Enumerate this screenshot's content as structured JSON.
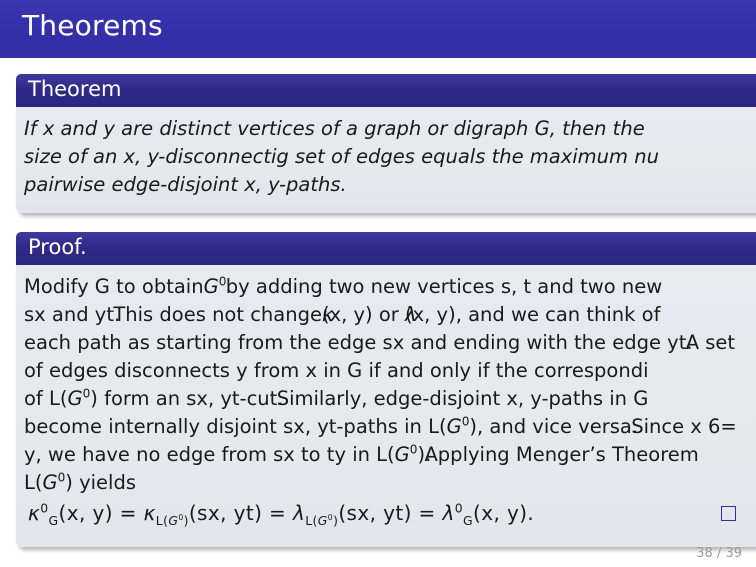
{
  "slide": {
    "title": "Theorems",
    "page_label": "38 / 39",
    "accent_color": "#332fa8",
    "block_head_color": "#2b2680",
    "block_body_color": "#e7e7f0",
    "page_number_color": "#9b9b9b"
  },
  "theorem_block": {
    "heading": "Theorem",
    "lines": [
      "If x and y are distinct vertices of a graph or digraph G, then the",
      "size of an x, y-disconnectig set of edges equals the maximum nu",
      "pairwise edge-disjoint x, y-paths."
    ]
  },
  "proof_block": {
    "heading": "Proof.",
    "lines": [
      {
        "segments": [
          {
            "text": "Modify G to obtain",
            "style": "plain"
          },
          {
            "text": "G",
            "style": "italic-sup-zero"
          },
          {
            "text": " by adding two new vertices s, t and two new",
            "style": "plain",
            "overlap": true
          }
        ]
      },
      {
        "segments": [
          {
            "text": "sx and yt.",
            "style": "plain"
          },
          {
            "text": "This does not change",
            "style": "plain",
            "overlap": true
          },
          {
            "text": "κ",
            "style": "kappa-overlap"
          },
          {
            "text": "(x, y) or ",
            "style": "plain"
          },
          {
            "text": "λ",
            "style": "lambda-overlap"
          },
          {
            "text": "(x, y), and we can think of",
            "style": "plain"
          }
        ]
      },
      {
        "segments": [
          {
            "text": "each path as starting from the edge sx and ending with the edge yt.",
            "style": "plain"
          },
          {
            "text": "A set",
            "style": "plain",
            "overlap": true
          }
        ]
      },
      {
        "segments": [
          {
            "text": "of edges disconnects y from x in G if and only if the correspondi",
            "style": "plain"
          }
        ]
      },
      {
        "segments": [
          {
            "text": "of L(",
            "style": "plain"
          },
          {
            "text": "G",
            "style": "italic-sup-zero"
          },
          {
            "text": ") form an sx, yt-cut.",
            "style": "plain"
          },
          {
            "text": "Similarly, edge-disjoint x, y-paths in G",
            "style": "plain",
            "overlap": true
          }
        ]
      },
      {
        "segments": [
          {
            "text": "become internally disjoint sx, yt-paths in L(",
            "style": "plain"
          },
          {
            "text": "G",
            "style": "italic-sup-zero"
          },
          {
            "text": "), and vice versa.",
            "style": "plain"
          },
          {
            "text": "Since x 6=",
            "style": "plain",
            "overlap": true
          }
        ]
      },
      {
        "segments": [
          {
            "text": "y, we have no edge from sx to ty in L(",
            "style": "plain"
          },
          {
            "text": "G",
            "style": "italic-sup-zero"
          },
          {
            "text": ").",
            "style": "plain"
          },
          {
            "text": "Applying Menger’s Theorem",
            "style": "plain",
            "overlap": true
          }
        ]
      },
      {
        "segments": [
          {
            "text": "L(",
            "style": "plain"
          },
          {
            "text": "G",
            "style": "italic-sup-zero"
          },
          {
            "text": ") yields",
            "style": "plain"
          }
        ]
      }
    ],
    "formula": "κ⁰_G(x, y) = κ_L(G⁰)(sx, yt) = λ_L(G⁰)(sx, yt) = λ⁰_G(x, y).",
    "qed_symbol": "qed-box"
  }
}
